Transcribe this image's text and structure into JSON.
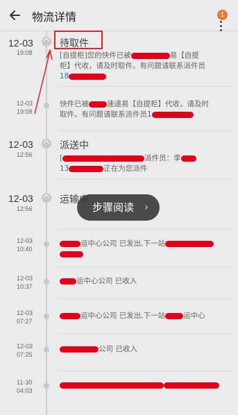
{
  "header": {
    "title": "物流详情",
    "badge_count": "1",
    "back_icon": "arrow-left-icon",
    "more_icon": "more-vertical-icon"
  },
  "timeline": [
    {
      "date": "12-03",
      "time": "19:08",
      "status": "待取件",
      "text1": "[自提柜]您的快件已被",
      "text2": "易【自提",
      "text3": "柜】代收，请及时取件。有问题请联系派件员",
      "phone": "18"
    },
    {
      "date": "12-03",
      "time": "19:08",
      "text1": "快件已被",
      "text2": "速递易【自提柜】代收，请及时",
      "text3": "取件。有问题请联系派件员",
      "phone": "1"
    },
    {
      "date": "12-03",
      "time": "12:56",
      "status": "派送中",
      "text1": "[",
      "text2": "派件员：李",
      "phone": "13",
      "text3": "正在为您派件"
    },
    {
      "date": "12-03",
      "time": "12:56",
      "status": "运输中"
    },
    {
      "date": "12-03",
      "time": "10:40",
      "text1": "运中心公司 已发出,下一站"
    },
    {
      "date": "12-03",
      "time": "10:37",
      "text1": "运中心公司 已收入"
    },
    {
      "date": "12-03",
      "time": "07:27",
      "text1": "运中心公司 已发出,下一站",
      "text2": "运中心"
    },
    {
      "date": "12-03",
      "time": "07:25",
      "text1": "公司 已收入"
    },
    {
      "date": "11-30",
      "time": "04:03",
      "text1": ""
    }
  ],
  "reading_pill": {
    "label": "步骤阅读",
    "chevron": "›"
  },
  "colors": {
    "background": "#ebebeb",
    "badge": "#f0743d",
    "phone_link": "#1d6fd1",
    "annotation_red": "#e0232a",
    "redaction_red": "#e3001a"
  }
}
